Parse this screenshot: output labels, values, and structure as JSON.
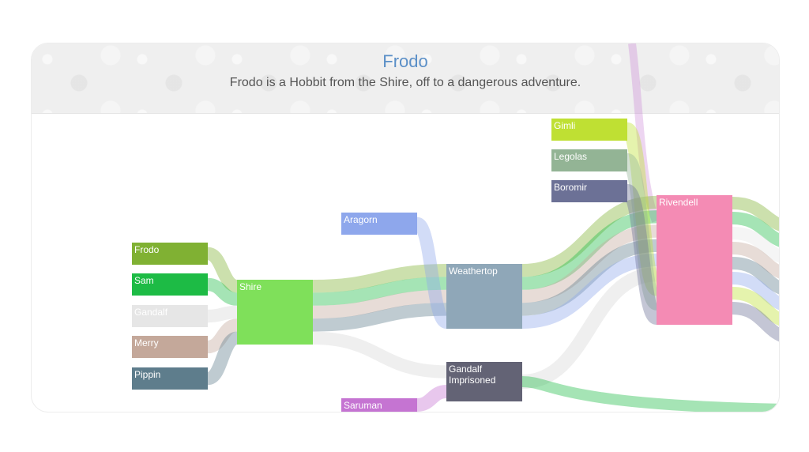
{
  "header": {
    "title": "Frodo",
    "subtitle": "Frodo is a Hobbit from the Shire, off to a dangerous adventure."
  },
  "chart_data": {
    "type": "sankey",
    "nodes": [
      {
        "id": "frodo",
        "label": [
          "Frodo"
        ],
        "color": "#80b133"
      },
      {
        "id": "sam",
        "label": [
          "Sam"
        ],
        "color": "#1dbb45"
      },
      {
        "id": "gandalf",
        "label": [
          "Gandalf"
        ],
        "color": "#e6e6e6"
      },
      {
        "id": "merry",
        "label": [
          "Merry"
        ],
        "color": "#c4a89a"
      },
      {
        "id": "pippin",
        "label": [
          "Pippin"
        ],
        "color": "#5e7d8c"
      },
      {
        "id": "shire",
        "label": [
          "Shire"
        ],
        "color": "#7fe05a"
      },
      {
        "id": "aragorn",
        "label": [
          "Aragorn"
        ],
        "color": "#8ea7ec"
      },
      {
        "id": "weathertop",
        "label": [
          "Weathertop"
        ],
        "color": "#8fa7b8"
      },
      {
        "id": "gandalf_imprisoned",
        "label": [
          "Gandalf",
          "Imprisoned"
        ],
        "color": "#636375"
      },
      {
        "id": "saruman",
        "label": [
          "Saruman"
        ],
        "color": "#c574d2"
      },
      {
        "id": "gimli",
        "label": [
          "Gimli"
        ],
        "color": "#bfe033"
      },
      {
        "id": "legolas",
        "label": [
          "Legolas"
        ],
        "color": "#93b495"
      },
      {
        "id": "boromir",
        "label": [
          "Boromir"
        ],
        "color": "#6c7196"
      },
      {
        "id": "rivendell",
        "label": [
          "Rivendell"
        ],
        "color": "#f48bb4"
      }
    ],
    "links": [
      {
        "source": "frodo",
        "target": "shire",
        "value": 1,
        "color": "#80b133"
      },
      {
        "source": "sam",
        "target": "shire",
        "value": 1,
        "color": "#1dbb45"
      },
      {
        "source": "gandalf",
        "target": "shire",
        "value": 1,
        "color": "#d8d8d8"
      },
      {
        "source": "merry",
        "target": "shire",
        "value": 1,
        "color": "#c4a89a"
      },
      {
        "source": "pippin",
        "target": "shire",
        "value": 1,
        "color": "#5e7d8c"
      },
      {
        "source": "shire",
        "target": "weathertop",
        "value": 1,
        "color": "#80b133"
      },
      {
        "source": "shire",
        "target": "weathertop",
        "value": 1,
        "color": "#1dbb45"
      },
      {
        "source": "shire",
        "target": "weathertop",
        "value": 1,
        "color": "#c4a89a"
      },
      {
        "source": "shire",
        "target": "weathertop",
        "value": 1,
        "color": "#5e7d8c"
      },
      {
        "source": "shire",
        "target": "gandalf_imprisoned",
        "value": 1,
        "color": "#d8d8d8"
      },
      {
        "source": "aragorn",
        "target": "weathertop",
        "value": 1,
        "color": "#8ea7ec"
      },
      {
        "source": "saruman",
        "target": "gandalf_imprisoned",
        "value": 1,
        "color": "#c574d2"
      },
      {
        "source": "weathertop",
        "target": "rivendell",
        "value": 1,
        "color": "#80b133"
      },
      {
        "source": "weathertop",
        "target": "rivendell",
        "value": 1,
        "color": "#1dbb45"
      },
      {
        "source": "weathertop",
        "target": "rivendell",
        "value": 1,
        "color": "#c4a89a"
      },
      {
        "source": "weathertop",
        "target": "rivendell",
        "value": 1,
        "color": "#5e7d8c"
      },
      {
        "source": "weathertop",
        "target": "rivendell",
        "value": 1,
        "color": "#8ea7ec"
      },
      {
        "source": "gandalf_imprisoned",
        "target": "rivendell",
        "value": 1,
        "color": "#d8d8d8"
      },
      {
        "source": "gimli",
        "target": "rivendell",
        "value": 1,
        "color": "#bfe033"
      },
      {
        "source": "legolas",
        "target": "rivendell",
        "value": 1,
        "color": "#93b495"
      },
      {
        "source": "boromir",
        "target": "rivendell",
        "value": 1,
        "color": "#6c7196"
      }
    ]
  }
}
